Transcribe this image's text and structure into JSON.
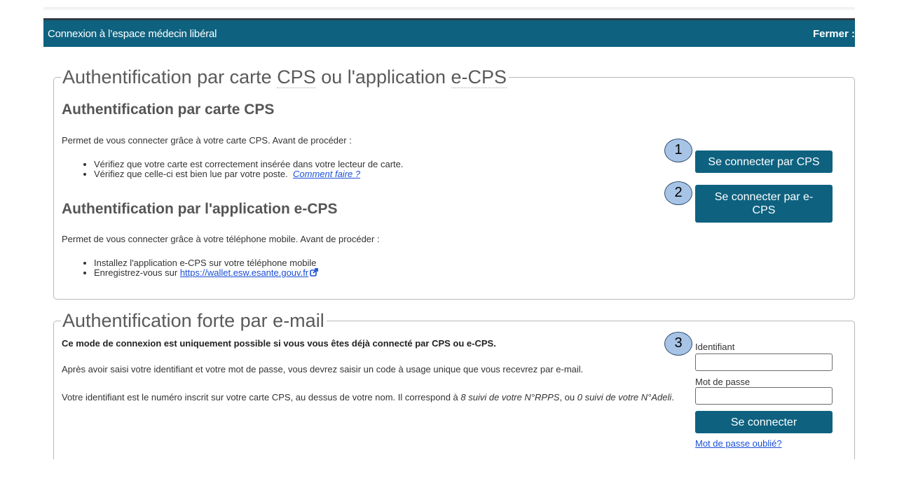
{
  "window": {
    "title": "Connexion à l’espace médecin libéral",
    "close_label": "Fermer :"
  },
  "section_cps": {
    "legend_prefix": "Authentification par carte ",
    "legend_cps": "CPS",
    "legend_middle": " ou l'application ",
    "legend_ecps": "e-CPS",
    "card": {
      "heading": "Authentification par carte CPS",
      "intro": "Permet de vous connecter grâce à votre carte CPS. Avant de procéder :",
      "bullet_1": "Vérifiez que votre carte est correctement insérée dans votre lecteur de carte.",
      "bullet_2": "Vérifiez que celle-ci est bien lue par votre poste.",
      "help_link": "Comment faire ?"
    },
    "app": {
      "heading": "Authentification par l'application e-CPS",
      "intro": "Permet de vous connecter grâce à votre téléphone mobile. Avant de procéder :",
      "bullet_1": "Installez l'application e-CPS sur votre téléphone mobile",
      "bullet_2_prefix": "Enregistrez-vous sur ",
      "wallet_link": "https://wallet.esw.esante.gouv.fr"
    },
    "buttons": {
      "cps": "Se connecter par CPS",
      "ecps_line1": "Se connecter par e-",
      "ecps_line2": "CPS"
    }
  },
  "section_email": {
    "legend": "Authentification forte par e-mail",
    "notice": "Ce mode de connexion est uniquement possible si vous vous êtes déjà connecté par CPS ou e-CPS.",
    "para_1": "Après avoir saisi votre identifiant et votre mot de passe, vous devrez saisir un code à usage unique que vous recevrez par e-mail.",
    "para_2_prefix": "Votre identifiant est le numéro inscrit sur votre carte CPS, au dessus de votre nom. Il correspond à ",
    "para_2_rpps": "8 suivi de votre N°RPPS",
    "para_2_middle": ", ou ",
    "para_2_adeli": "0 suivi de votre N°Adeli",
    "para_2_suffix": ".",
    "form": {
      "id_label": "Identifiant",
      "id_value": "",
      "password_label": "Mot de passe",
      "password_value": "",
      "submit": "Se connecter",
      "forgot_link": "Mot de passe oublié?"
    }
  },
  "badges": [
    "1",
    "2",
    "3"
  ],
  "colors": {
    "title_bar": "#0e6280",
    "button": "#0e6280",
    "badge_fill": "#a7c4e6",
    "link": "#1a4fd6"
  },
  "icons": {
    "external_link": "external-link-icon"
  }
}
